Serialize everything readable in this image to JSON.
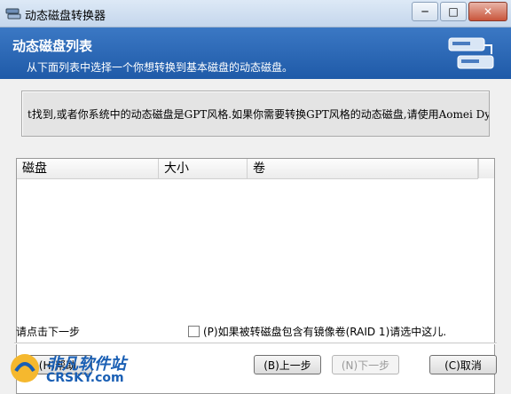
{
  "window": {
    "title": "动态磁盘转换器",
    "min": "─",
    "max": "□",
    "close": "✕"
  },
  "header": {
    "title": "动态磁盘列表",
    "subtitle": "从下面列表中选择一个你想转换到基本磁盘的动态磁盘。"
  },
  "message": "t找到,或者你系统中的动态磁盘是GPT风格.如果你需要转换GPT风格的动态磁盘,请使用Aomei Dyna",
  "table": {
    "columns": [
      "磁盘",
      "大小",
      "卷"
    ],
    "rows": []
  },
  "hint": "请点击下一步",
  "checkbox": {
    "label": "(P)如果被转磁盘包含有镜像卷(RAID 1)请选中这儿.",
    "checked": false
  },
  "buttons": {
    "help": "(H)帮助",
    "back": "(B)上一步",
    "next": "(N)下一步",
    "cancel": "(C)取消"
  },
  "watermark": {
    "line1": "非凡软件站",
    "line2": "CRSKY.com"
  },
  "colors": {
    "header_bg": "#2a66b6",
    "brand": "#1a5fb4"
  }
}
